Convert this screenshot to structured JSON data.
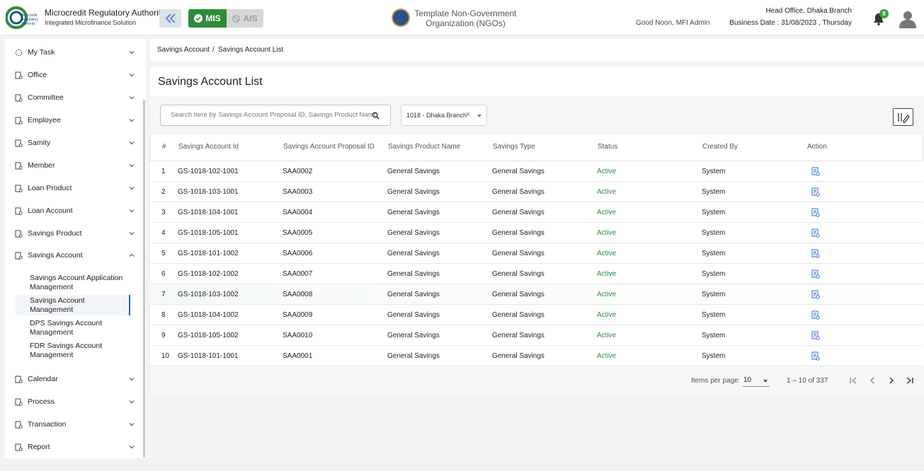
{
  "header": {
    "brand_title": "Microcredit Regulatory Authority",
    "brand_subtitle": "Integrated Microfinance Solution",
    "logo_text": "Microcredit Regulatory Authority",
    "mis_label": "MIS",
    "ais_label": "AIS",
    "org_name": "Template Non-Government Organization (NGOs)",
    "greeting": "Good Noon, MFI Admin",
    "branch": "Head Office, Dhaka Branch",
    "business_date": "Business Date : 31/08/2023 , Thursday",
    "notification_count": "8",
    "accent_color": "#2e8b3a"
  },
  "sidebar": {
    "items": [
      {
        "label": "My Task",
        "icon": "task-icon"
      },
      {
        "label": "Office",
        "icon": "office-icon"
      },
      {
        "label": "Committee",
        "icon": "committee-icon"
      },
      {
        "label": "Employee",
        "icon": "employee-icon"
      },
      {
        "label": "Samity",
        "icon": "samity-icon"
      },
      {
        "label": "Member",
        "icon": "member-icon"
      },
      {
        "label": "Loan Product",
        "icon": "loan-product-icon"
      },
      {
        "label": "Loan Account",
        "icon": "loan-account-icon"
      },
      {
        "label": "Savings Product",
        "icon": "savings-product-icon"
      },
      {
        "label": "Savings Account",
        "icon": "savings-account-icon"
      },
      {
        "label": "Calendar",
        "icon": "calendar-icon"
      },
      {
        "label": "Process",
        "icon": "process-icon"
      },
      {
        "label": "Transaction",
        "icon": "transaction-icon"
      },
      {
        "label": "Report",
        "icon": "report-icon"
      }
    ],
    "sub_items": [
      {
        "label": "Savings Account Application Management"
      },
      {
        "label": "Savings Account Management",
        "active": true
      },
      {
        "label": "DPS Savings Account Management"
      },
      {
        "label": "FDR Savings Account Management"
      }
    ]
  },
  "breadcrumb": {
    "parent": "Savings Account",
    "separator": "/",
    "current": "Savings Account List"
  },
  "main": {
    "title": "Savings Account List",
    "search_placeholder": "Search here by Savings Account Proposal ID, Savings Product Name or",
    "branch_filter": "1018 - Dhaka Branch",
    "branch_clear": "×",
    "columns": [
      "#",
      "Savings Account Id",
      "Savings Account Proposal ID",
      "Savings Product Name",
      "Savings Type",
      "Status",
      "Created By",
      "Action"
    ],
    "rows": [
      [
        "1",
        "GS-1018-102-1001",
        "SAA0002",
        "General Savings",
        "General Savings",
        "Active",
        "System"
      ],
      [
        "2",
        "GS-1018-103-1001",
        "SAA0003",
        "General Savings",
        "General Savings",
        "Active",
        "System"
      ],
      [
        "3",
        "GS-1018-104-1001",
        "SAA0004",
        "General Savings",
        "General Savings",
        "Active",
        "System"
      ],
      [
        "4",
        "GS-1018-105-1001",
        "SAA0005",
        "General Savings",
        "General Savings",
        "Active",
        "System"
      ],
      [
        "5",
        "GS-1018-101-1002",
        "SAA0006",
        "General Savings",
        "General Savings",
        "Active",
        "System"
      ],
      [
        "6",
        "GS-1018-102-1002",
        "SAA0007",
        "General Savings",
        "General Savings",
        "Active",
        "System"
      ],
      [
        "7",
        "GS-1018-103-1002",
        "SAA0008",
        "General Savings",
        "General Savings",
        "Active",
        "System"
      ],
      [
        "8",
        "GS-1018-104-1002",
        "SAA0009",
        "General Savings",
        "General Savings",
        "Active",
        "System"
      ],
      [
        "9",
        "GS-1018-105-1002",
        "SAA0010",
        "General Savings",
        "General Savings",
        "Active",
        "System"
      ],
      [
        "10",
        "GS-1018-101-1001",
        "SAA0001",
        "General Savings",
        "General Savings",
        "Active",
        "System"
      ]
    ],
    "status_color": "#2e8b3a"
  },
  "pagination": {
    "items_per_page_label": "Items per page:",
    "items_per_page": "10",
    "range": "1 – 10 of 337"
  }
}
